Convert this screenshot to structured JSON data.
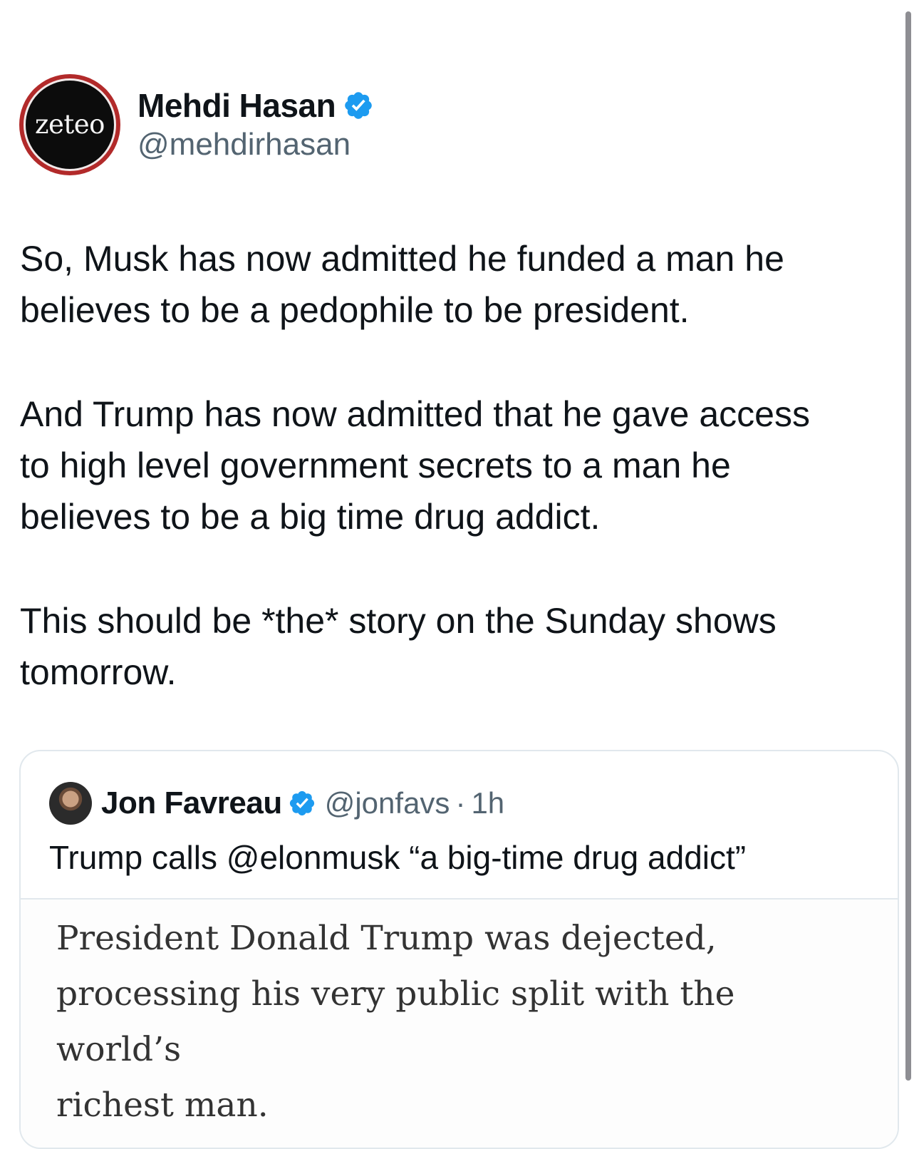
{
  "tweet": {
    "author": {
      "name": "Mehdi Hasan",
      "handle": "@mehdirhasan",
      "avatar_text": "zeteo",
      "verified_icon": "verified-badge-icon"
    },
    "paragraphs": [
      "So, Musk has now admitted he funded a man he\nbelieves to be a pedophile to be president.",
      "And Trump has now admitted that he gave access\nto high level government secrets to a man he\nbelieves to be a big time drug addict.",
      "This should be *the* story on the Sunday shows\ntomorrow."
    ]
  },
  "quote": {
    "author": {
      "name": "Jon Favreau",
      "handle": "@jonfavs",
      "separator": "·",
      "time": "1h",
      "verified_icon": "verified-badge-icon"
    },
    "text": "Trump calls @elonmusk “a big-time drug addict”",
    "media_text": "President Donald Trump was dejected,\nprocessing his very public split with the world’s\nrichest man."
  },
  "colors": {
    "text_primary": "#0f1419",
    "text_secondary": "#536471",
    "verified_blue": "#1d9bf0",
    "border": "#e1e8ed",
    "avatar_ring": "#b22a2a"
  }
}
